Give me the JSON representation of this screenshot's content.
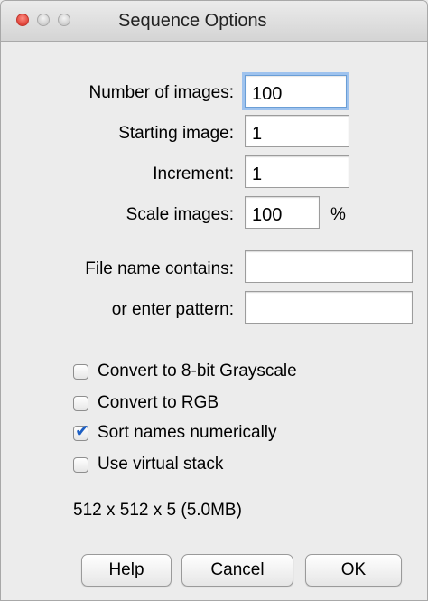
{
  "window": {
    "title": "Sequence Options"
  },
  "fields": {
    "number_of_images": {
      "label": "Number of images:",
      "value": "100"
    },
    "starting_image": {
      "label": "Starting image:",
      "value": "1"
    },
    "increment": {
      "label": "Increment:",
      "value": "1"
    },
    "scale_images": {
      "label": "Scale images:",
      "value": "100",
      "unit": "%"
    },
    "file_name_contains": {
      "label": "File name contains:",
      "value": ""
    },
    "enter_pattern": {
      "label": "or enter pattern:",
      "value": ""
    }
  },
  "checkboxes": [
    {
      "label": "Convert to 8-bit Grayscale",
      "checked": false
    },
    {
      "label": "Convert to RGB",
      "checked": false
    },
    {
      "label": "Sort names numerically",
      "checked": true
    },
    {
      "label": "Use virtual stack",
      "checked": false
    }
  ],
  "info_text": "512 x 512 x 5 (5.0MB)",
  "buttons": {
    "help": "Help",
    "cancel": "Cancel",
    "ok": "OK"
  },
  "colors": {
    "checkmark": "#1c5fc4",
    "focus_ring": "#9fc3ee",
    "close_light": "#e0443a"
  },
  "icons": {
    "checked": "check-icon"
  }
}
